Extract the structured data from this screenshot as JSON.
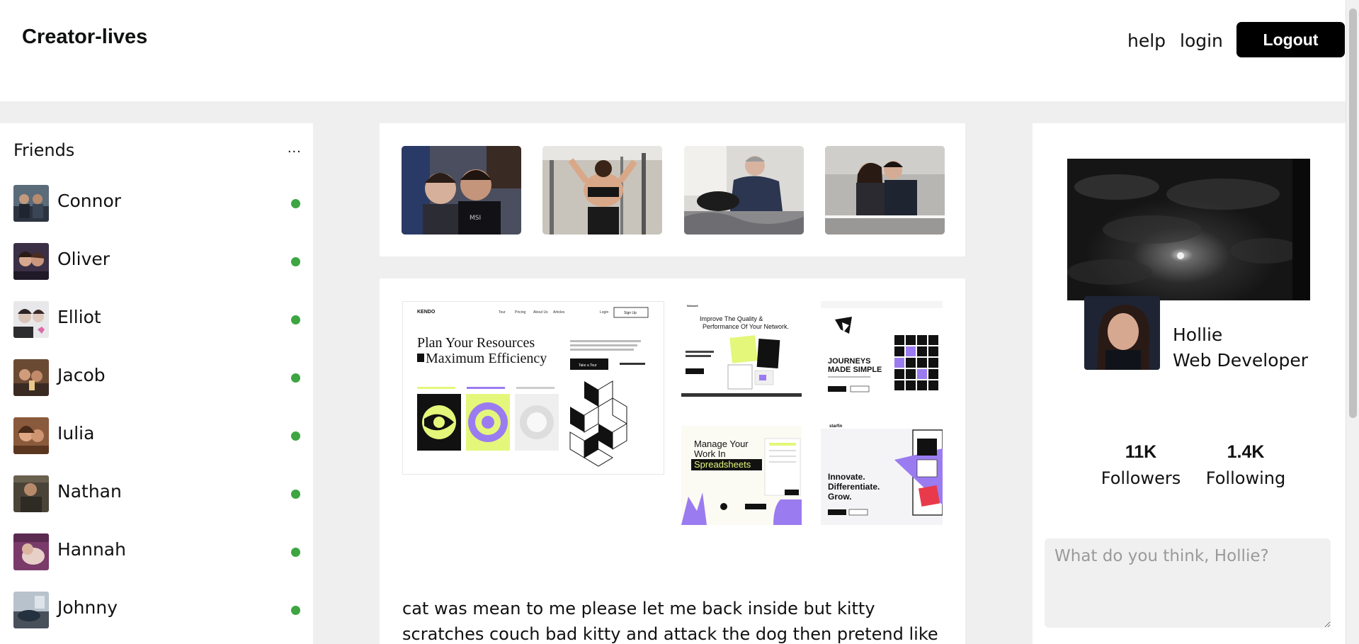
{
  "header": {
    "brand": "Creator-lives",
    "nav": {
      "help": "help",
      "login": "login",
      "logout": "Logout"
    }
  },
  "friends": {
    "title": "Friends",
    "more": "...",
    "items": [
      {
        "name": "Connor",
        "online": true
      },
      {
        "name": "Oliver",
        "online": true
      },
      {
        "name": "Elliot",
        "online": true
      },
      {
        "name": "Jacob",
        "online": true
      },
      {
        "name": "Iulia",
        "online": true
      },
      {
        "name": "Nathan",
        "online": true
      },
      {
        "name": "Hannah",
        "online": true
      },
      {
        "name": "Johnny",
        "online": true
      }
    ]
  },
  "post": {
    "gallery": {
      "kendo": {
        "brand": "KENDO",
        "nav": [
          "Tour",
          "Pricing",
          "About Us",
          "Articles"
        ],
        "login": "Login",
        "signup": "Sign Up",
        "headline1": "Plan Your Resources",
        "headline2": "Maximum Efficiency",
        "tour": "Take a Tour"
      },
      "network": {
        "brand": "Network",
        "headline1": "Improve The Quality &",
        "headline2": "Performance Of Your Network."
      },
      "journeys": {
        "headline1": "JOURNEYS",
        "headline2": "MADE SIMPLE"
      },
      "spreadsheets": {
        "headline1": "Manage Your",
        "headline2": "Work In",
        "headline3": "Spreadsheets"
      },
      "starfin": {
        "brand": "starfin",
        "headline1": "Innovate.",
        "headline2": "Differentiate.",
        "headline3": "Grow."
      }
    },
    "text": "cat was mean to me please let me back inside but kitty scratches couch bad kitty and attack the dog then pretend like nothing"
  },
  "profile": {
    "name": "Hollie",
    "role": "Web Developer",
    "followers_count": "11K",
    "followers_label": "Followers",
    "following_count": "1.4K",
    "following_label": "Following",
    "composer_placeholder": "What do you think, Hollie?"
  },
  "colors": {
    "online": "#3da542",
    "background": "#efefef",
    "logout_bg": "#000000",
    "accent_purple": "#9b7bf0",
    "accent_lime": "#e4f77a"
  }
}
